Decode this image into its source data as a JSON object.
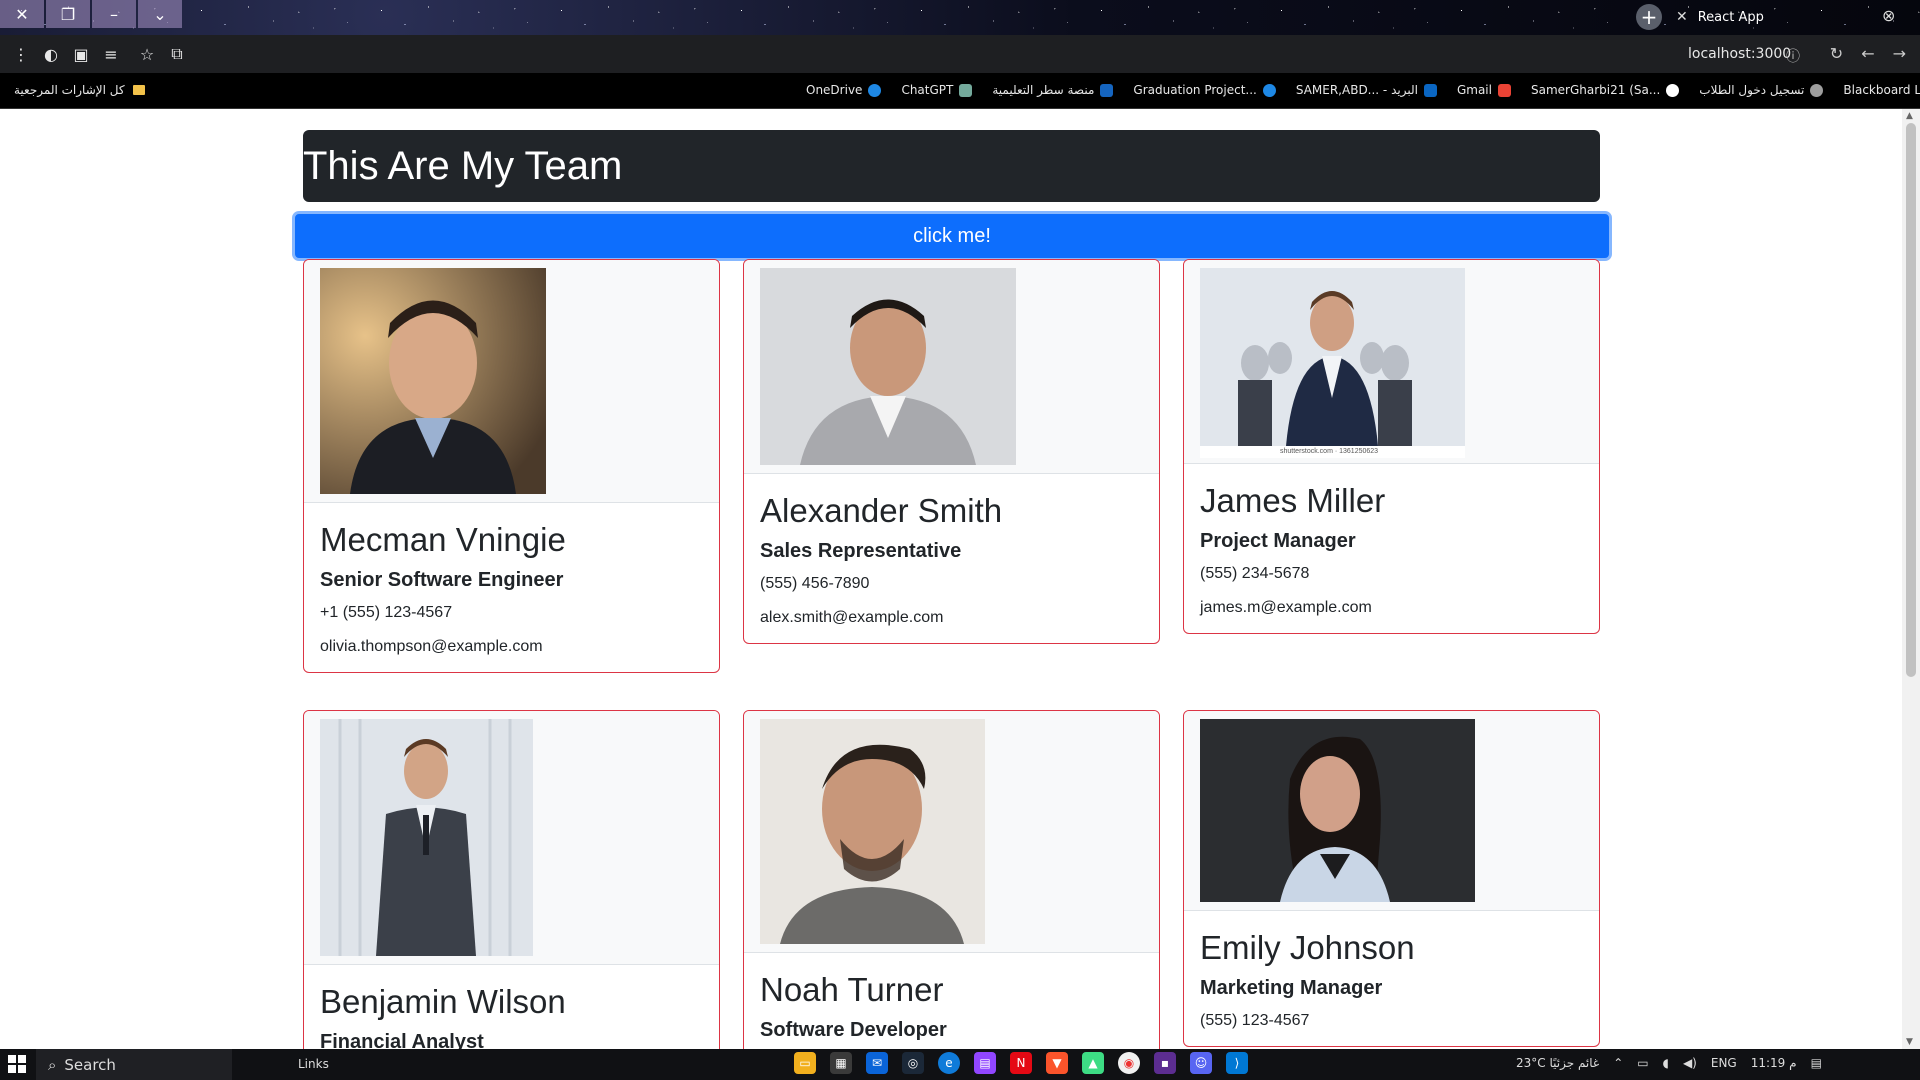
{
  "browser": {
    "tab_title": "React App",
    "url": "localhost:3000",
    "window_controls": [
      "close-icon",
      "restore-icon",
      "minimize-icon",
      "dropdown-icon"
    ]
  },
  "bookmarks": {
    "all_bookmarks": "كل الإشارات المرجعية",
    "items": [
      {
        "label": "OneDrive",
        "color": "#1e88e5"
      },
      {
        "label": "ChatGPT",
        "color": "#74aa9c"
      },
      {
        "label": "منصة سطر التعليمية",
        "color": "#1565c0"
      },
      {
        "label": "Graduation Project...",
        "color": "#1e88e5"
      },
      {
        "label": "SAMER,ABD... - البريد",
        "color": "#0a66c2"
      },
      {
        "label": "Gmail",
        "color": "#ea4335"
      },
      {
        "label": "SamerGharbi21 (Sa...",
        "color": "#ffffff"
      },
      {
        "label": "تسجيل دخول الطلاب",
        "color": "#9e9e9e"
      },
      {
        "label": "Blackboard Learn",
        "color": "#f4b400"
      }
    ]
  },
  "page": {
    "title": "This Are My Team",
    "button_label": "click me!"
  },
  "team": [
    {
      "name": "Mecman Vningie",
      "role": "Senior Software Engineer",
      "phone": "+1 (555) 123-4567",
      "email": "olivia.thompson@example.com",
      "photo_bg": "#b0885a"
    },
    {
      "name": "Alexander Smith",
      "role": "Sales Representative",
      "phone": "(555) 456-7890",
      "email": "alex.smith@example.com",
      "photo_bg": "#d8dadd"
    },
    {
      "name": "James Miller",
      "role": "Project Manager",
      "phone": "(555) 234-5678",
      "email": "james.m@example.com",
      "photo_bg": "#e9ecef",
      "photo_caption": "shutterstock.com · 1361250623"
    },
    {
      "name": "Benjamin Wilson",
      "role": "Financial Analyst",
      "phone": "",
      "email": "",
      "photo_bg": "#dfe4ea"
    },
    {
      "name": "Noah Turner",
      "role": "Software Developer",
      "phone": "",
      "email": "",
      "photo_bg": "#e9e6e1"
    },
    {
      "name": "Emily Johnson",
      "role": "Marketing Manager",
      "phone": "(555) 123-4567",
      "email": "",
      "photo_bg": "#2b2d30"
    }
  ],
  "taskbar": {
    "search_label": "Search",
    "links_label": "Links",
    "weather": "23°C غائم جزئيًا",
    "language": "ENG",
    "time": "11:19 م"
  },
  "colors": {
    "card_border": "#dc3545",
    "button_primary": "#0d6efd",
    "header_bg": "#212529"
  }
}
